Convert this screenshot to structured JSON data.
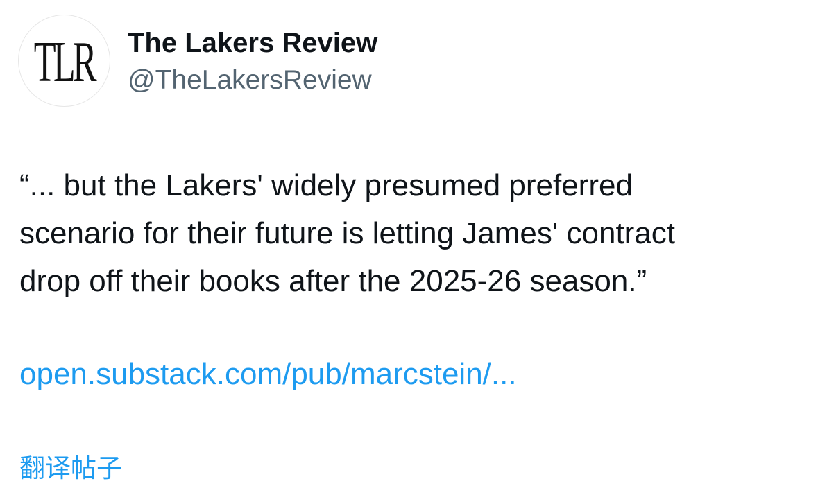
{
  "author": {
    "avatar_text": "TLR",
    "display_name": "The Lakers Review",
    "handle": "@TheLakersReview"
  },
  "tweet": {
    "text_lines": [
      "“... but the Lakers' widely presumed preferred",
      "scenario for their future is letting James' contract",
      "drop off their books after the 2025-26 season.”"
    ],
    "link_text": "open.substack.com/pub/marcstein/...",
    "translate_label": "翻译帖子"
  },
  "colors": {
    "text_primary": "#0f1419",
    "text_secondary": "#536471",
    "link": "#1d9bf0",
    "background": "#ffffff"
  }
}
